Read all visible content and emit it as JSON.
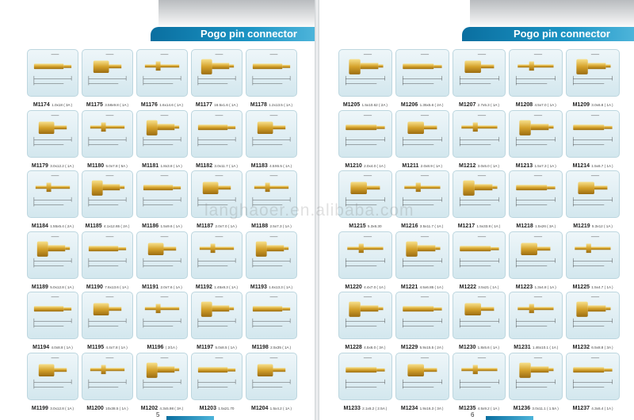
{
  "left_page": {
    "title": "Pogo pin connector",
    "page_number": "5",
    "products": [
      {
        "model": "M1174",
        "spec": "1.0x18 ( 3A )"
      },
      {
        "model": "M1175",
        "spec": "3.58x9.8 ( 1A )"
      },
      {
        "model": "M1176",
        "spec": "1.6x14.6 ( 1A )"
      },
      {
        "model": "M1177",
        "spec": "16.5x1.6 ( 1A )"
      },
      {
        "model": "M1178",
        "spec": "1.2x13.5 ( 1A )"
      },
      {
        "model": "M1179",
        "spec": "3.0x12.2 ( 1A )"
      },
      {
        "model": "M1180",
        "spec": "5.0x7.8 ( 5A )"
      },
      {
        "model": "M1181",
        "spec": "1.8x3.8 ( 1A )"
      },
      {
        "model": "M1182",
        "spec": "3.0x11.7 ( 1A )"
      },
      {
        "model": "M1183",
        "spec": "4.5X6.5 ( 1A )"
      },
      {
        "model": "M1184",
        "spec": "1.55x5.4 ( 2A )"
      },
      {
        "model": "M1185",
        "spec": "4.1x12.65 ( 2A )"
      },
      {
        "model": "M1186",
        "spec": "1.5x9.6 ( 1A )"
      },
      {
        "model": "M1187",
        "spec": "2.0x7.0 ( 1A )"
      },
      {
        "model": "M1188",
        "spec": "2.5x7.3 ( 1A )"
      },
      {
        "model": "M1189",
        "spec": "5.0x12.8 ( 1A )"
      },
      {
        "model": "M1190",
        "spec": "7.6x13.6 ( 1A )"
      },
      {
        "model": "M1191",
        "spec": "2.0x7.6 ( 1A )"
      },
      {
        "model": "M1192",
        "spec": "1.45x8.3 ( 1A )"
      },
      {
        "model": "M1193",
        "spec": "1.6x13.3 ( 1A )"
      },
      {
        "model": "M1194",
        "spec": "4.0x8.8 ( 1A )"
      },
      {
        "model": "M1195",
        "spec": "4.4x7.8 ( 1A )"
      },
      {
        "model": "M1196",
        "spec": "( 2/1A )"
      },
      {
        "model": "M1197",
        "spec": "5.0x8.5 ( 1A )"
      },
      {
        "model": "M1198",
        "spec": "2.5x35 ( 1A )"
      },
      {
        "model": "M1199",
        "spec": "3.0x12.8 ( 1A )"
      },
      {
        "model": "M1200",
        "spec": "10x38.5 ( 1A )"
      },
      {
        "model": "M1202",
        "spec": "4.3x5.98 ( 3A )"
      },
      {
        "model": "M1203",
        "spec": "1.5x21.70"
      },
      {
        "model": "M1204",
        "spec": "1.5x4.2 ( 1A )"
      }
    ]
  },
  "right_page": {
    "title": "Pogo pin connector",
    "page_number": "6",
    "products": [
      {
        "model": "M1205",
        "spec": "1.5x10.62 ( 2A )"
      },
      {
        "model": "M1206",
        "spec": "1.35x5.6 ( 2A )"
      },
      {
        "model": "M1207",
        "spec": "2.7x5.3 ( 1A )"
      },
      {
        "model": "M1208",
        "spec": "4.5x7.0 ( 1A )"
      },
      {
        "model": "M1209",
        "spec": "3.0x6.8 ( 1A )"
      },
      {
        "model": "M1210",
        "spec": "2.0x4.0 ( 1A )"
      },
      {
        "model": "M1211",
        "spec": "2.0x8.9 ( 1A )"
      },
      {
        "model": "M1212",
        "spec": "3.0x5.0 ( 1A )"
      },
      {
        "model": "M1213",
        "spec": "1.5x7.3 ( 1A )"
      },
      {
        "model": "M1214",
        "spec": "1.5x6.7 ( 1A )"
      },
      {
        "model": "M1215",
        "spec": "5.3x6.30"
      },
      {
        "model": "M1216",
        "spec": "3.5x11.7 ( 1A )"
      },
      {
        "model": "M1217",
        "spec": "1.5x33.8 ( 1A )"
      },
      {
        "model": "M1218",
        "spec": "1.5x26 ( 3A )"
      },
      {
        "model": "M1219",
        "spec": "5.3x12 ( 1A )"
      },
      {
        "model": "M1220",
        "spec": "4.4x7.0 ( 1A )"
      },
      {
        "model": "M1221",
        "spec": "4.5x6.85 ( 1A )"
      },
      {
        "model": "M1222",
        "spec": "3.5x21 ( 1A )"
      },
      {
        "model": "M1223",
        "spec": "1.3x4.8 ( 1A )"
      },
      {
        "model": "M1225",
        "spec": "1.5x4.7 ( 1A )"
      },
      {
        "model": "M1228",
        "spec": "4.5x6.0 ( 3A )"
      },
      {
        "model": "M1229",
        "spec": "5.9x15.5 ( 2A )"
      },
      {
        "model": "M1230",
        "spec": "1.8x5.6 ( 1A )"
      },
      {
        "model": "M1231",
        "spec": "1.46x10.1 ( 1A )"
      },
      {
        "model": "M1232",
        "spec": "6.5x8.8 ( 3A )"
      },
      {
        "model": "M1233",
        "spec": "2.1x6.2 ( 2.5A )"
      },
      {
        "model": "M1234",
        "spec": "1.9x16.3 ( 3A )"
      },
      {
        "model": "M1235",
        "spec": "4.5x9.2 ( 1A )"
      },
      {
        "model": "M1236",
        "spec": "3.0x11.1 ( 1.5A )"
      },
      {
        "model": "M1237",
        "spec": "4.3x6.4 ( 1A )"
      }
    ]
  },
  "watermark": "langhaoer.en.alibaba.com",
  "colors": {
    "banner": "#0a6fa0",
    "card": "#d3e7ee",
    "gold": "#d6a62a",
    "dim_line": "#333333"
  }
}
